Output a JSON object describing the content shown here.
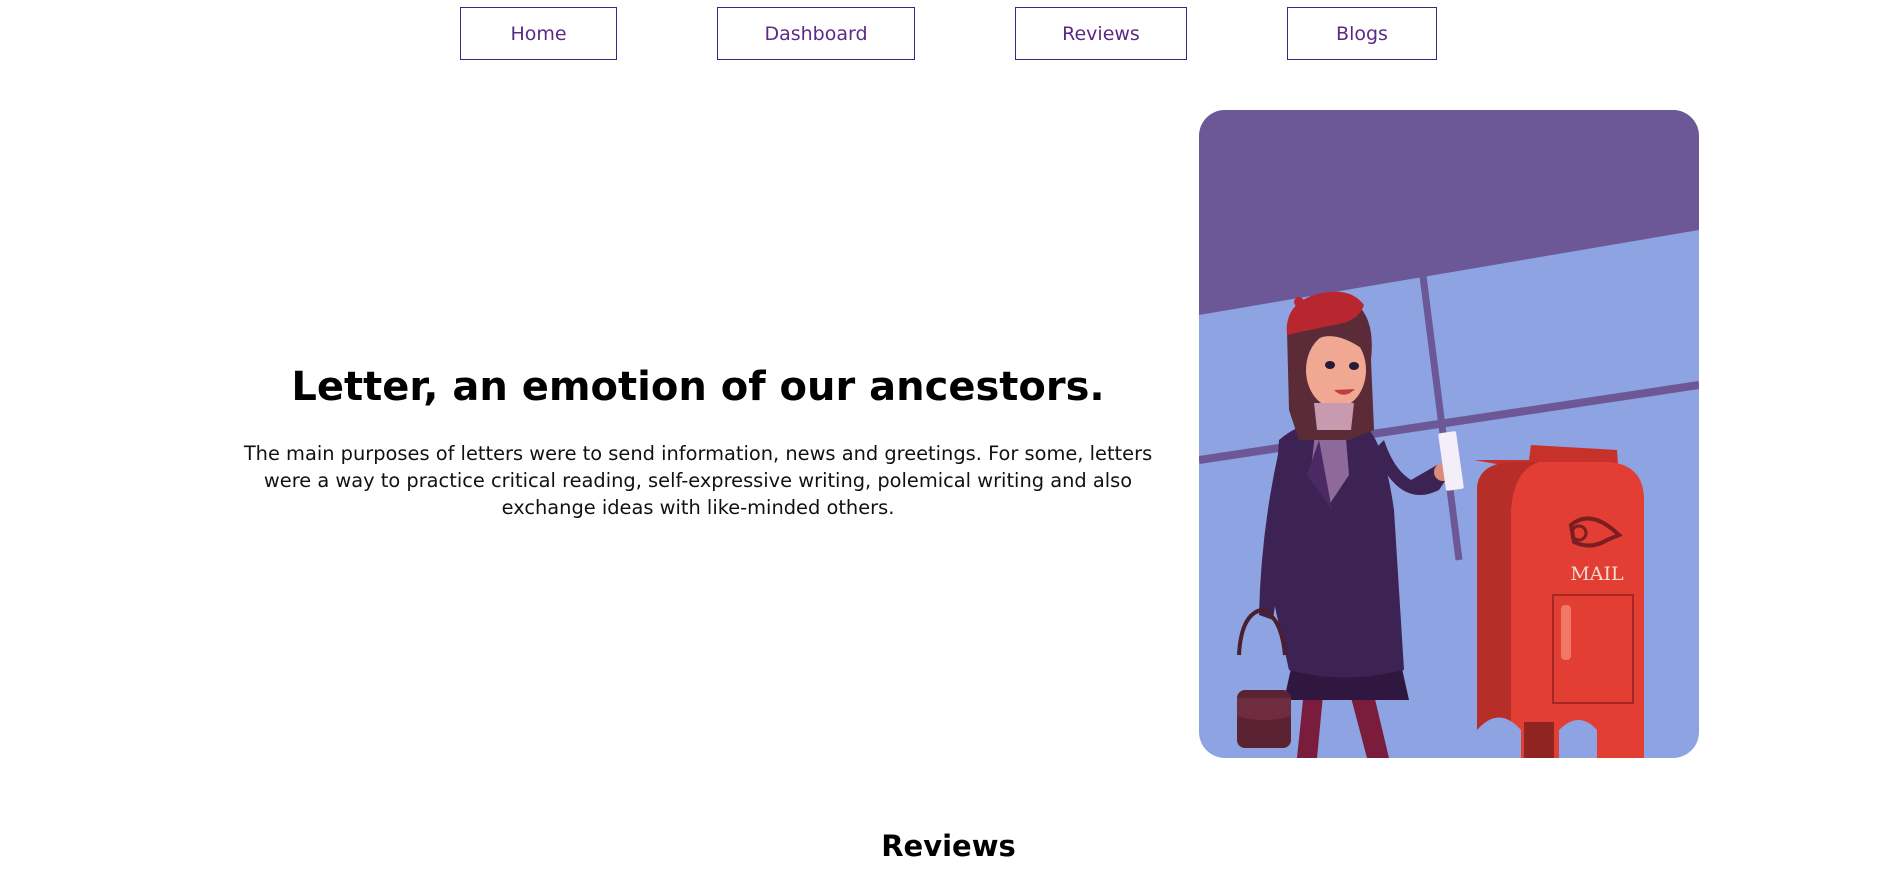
{
  "nav": {
    "items": [
      {
        "label": "Home"
      },
      {
        "label": "Dashboard"
      },
      {
        "label": "Reviews"
      },
      {
        "label": "Blogs"
      }
    ]
  },
  "hero": {
    "title": "Letter, an emotion of our ancestors.",
    "description": "The main purposes of letters were to send information, news and greetings. For some, letters were a way to practice critical reading, self-expressive writing, polemical writing and also exchange ideas with like-minded others.",
    "illustration": {
      "icon": "woman-posting-letter-illustration",
      "mailbox_label": "MAIL",
      "colors": {
        "sky": "#6c5896",
        "wall": "#8ea3e2",
        "mailbox": "#e23e33",
        "coat": "#3d2254"
      }
    }
  },
  "reviews": {
    "heading": "Reviews"
  },
  "colors": {
    "nav_border": "#2e2c8c",
    "nav_text": "#5a2a86"
  }
}
